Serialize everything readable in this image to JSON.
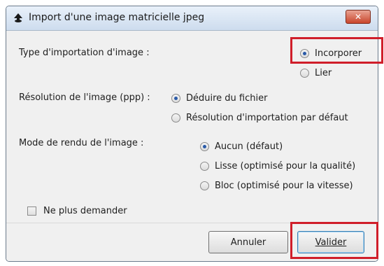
{
  "dialog": {
    "title": "Import d'une image matricielle jpeg",
    "close_label": "✕"
  },
  "import_type": {
    "label": "Type d'importation d'image :",
    "options": [
      "Incorporer",
      "Lier"
    ],
    "selected": "Incorporer"
  },
  "resolution": {
    "label": "Résolution de l'image (ppp) :",
    "options": [
      "Déduire du fichier",
      "Résolution d'importation par défaut"
    ],
    "selected": "Déduire du fichier"
  },
  "render_mode": {
    "label": "Mode de rendu de l'image :",
    "options": [
      "Aucun (défaut)",
      "Lisse (optimisé pour la qualité)",
      "Bloc (optimisé pour la vitesse)"
    ],
    "selected": "Aucun (défaut)"
  },
  "dont_ask": {
    "label": "Ne plus demander"
  },
  "buttons": {
    "cancel": "Annuler",
    "ok": "Valider"
  },
  "colors": {
    "highlight": "#d01e2a",
    "radio_selected": "#2a5aa8"
  }
}
